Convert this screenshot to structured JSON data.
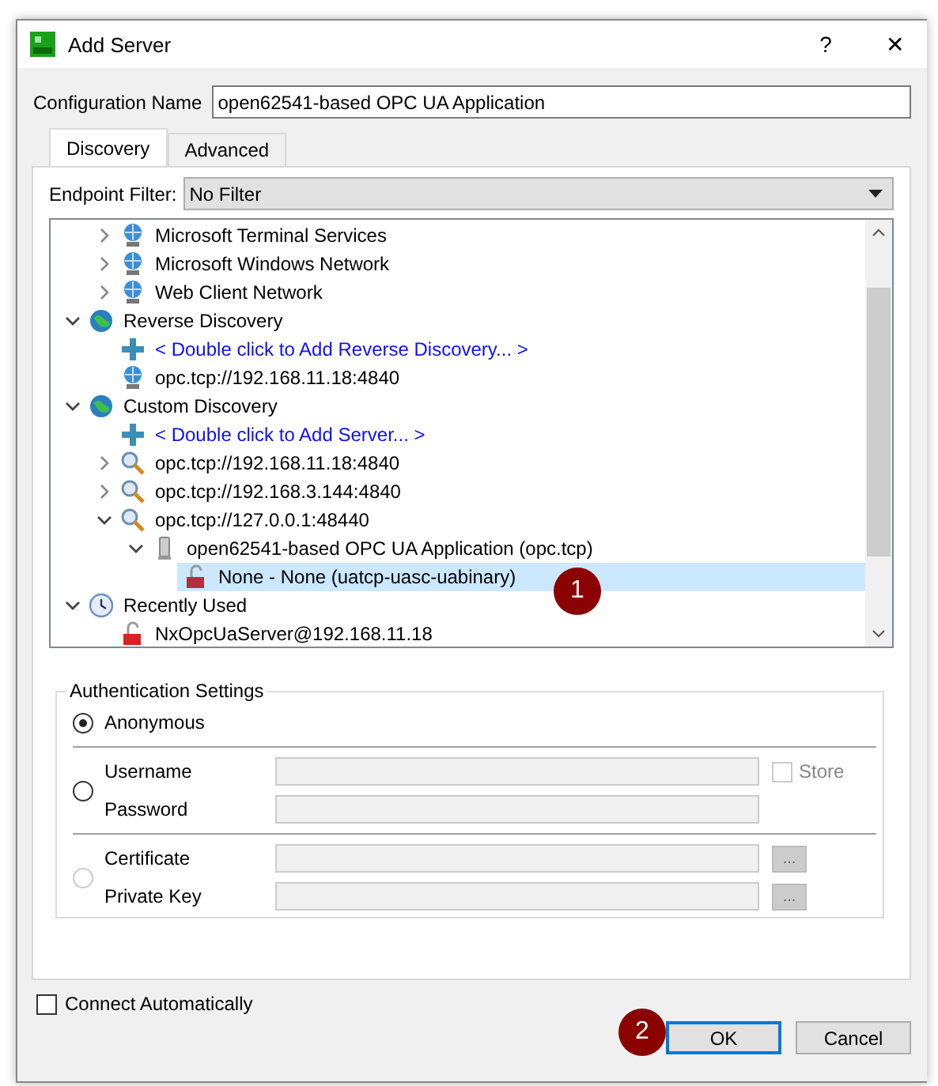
{
  "window": {
    "title": "Add Server",
    "help": "?",
    "close": "✕"
  },
  "configuration_name": {
    "label": "Configuration Name",
    "value": "open62541-based OPC UA Application"
  },
  "tabs": [
    {
      "label": "Discovery",
      "selected": true
    },
    {
      "label": "Advanced",
      "selected": false
    }
  ],
  "endpoint_filter": {
    "label": "Endpoint Filter:",
    "value": "No Filter"
  },
  "tree": {
    "items": [
      {
        "children": [
          {
            "label": "Microsoft Terminal Services",
            "kind": "network",
            "expanded": false,
            "selected": false
          },
          {
            "label": "Microsoft Windows Network",
            "kind": "network",
            "expanded": false,
            "selected": false
          },
          {
            "label": "Web Client Network",
            "kind": "network",
            "expanded": false,
            "selected": false
          }
        ]
      },
      {
        "label": "Reverse Discovery",
        "kind": "globe",
        "expanded": true,
        "selected": false,
        "children": [
          {
            "label": "< Double click to Add Reverse Discovery... >",
            "kind": "add",
            "selected": false
          },
          {
            "label": "opc.tcp://192.168.11.18:4840",
            "kind": "network",
            "selected": false
          }
        ]
      },
      {
        "label": "Custom Discovery",
        "kind": "globe",
        "expanded": true,
        "selected": false,
        "children": [
          {
            "label": "< Double click to Add Server... >",
            "kind": "add",
            "selected": false
          },
          {
            "label": "opc.tcp://192.168.11.18:4840",
            "kind": "search",
            "expanded": false,
            "selected": false
          },
          {
            "label": "opc.tcp://192.168.3.144:4840",
            "kind": "search",
            "expanded": false,
            "selected": false
          },
          {
            "label": "opc.tcp://127.0.0.1:48440",
            "kind": "search",
            "expanded": true,
            "selected": false,
            "children": [
              {
                "label": "open62541-based OPC UA Application (opc.tcp)",
                "kind": "server",
                "expanded": true,
                "selected": false,
                "children": [
                  {
                    "label": "None - None (uatcp-uasc-uabinary)",
                    "kind": "lock",
                    "selected": true
                  }
                ]
              }
            ]
          }
        ]
      },
      {
        "label": "Recently Used",
        "kind": "clock",
        "expanded": true,
        "selected": false,
        "children": [
          {
            "label": "NxOpcUaServer@192.168.11.18",
            "kind": "lock",
            "selected": false
          }
        ]
      }
    ]
  },
  "authentication": {
    "title": "Authentication Settings",
    "options": [
      {
        "kind": "anonymous",
        "selected": true,
        "disabled": false,
        "label": "Anonymous"
      },
      {
        "kind": "credentials",
        "selected": false,
        "disabled": false,
        "fields": [
          {
            "label": "Username",
            "store": {
              "label": "Store",
              "checked": false,
              "disabled": true
            }
          },
          {
            "label": "Password"
          }
        ]
      },
      {
        "kind": "certificate",
        "selected": false,
        "disabled": true,
        "fields": [
          {
            "label": "Certificate",
            "browse": "..."
          },
          {
            "label": "Private Key",
            "browse": "..."
          }
        ]
      }
    ]
  },
  "connect_automatically": {
    "label": "Connect Automatically",
    "checked": false
  },
  "buttons": [
    {
      "label": "OK",
      "default": true
    },
    {
      "label": "Cancel",
      "default": false
    }
  ],
  "callouts": [
    {
      "text": "1"
    },
    {
      "text": "2"
    }
  ]
}
